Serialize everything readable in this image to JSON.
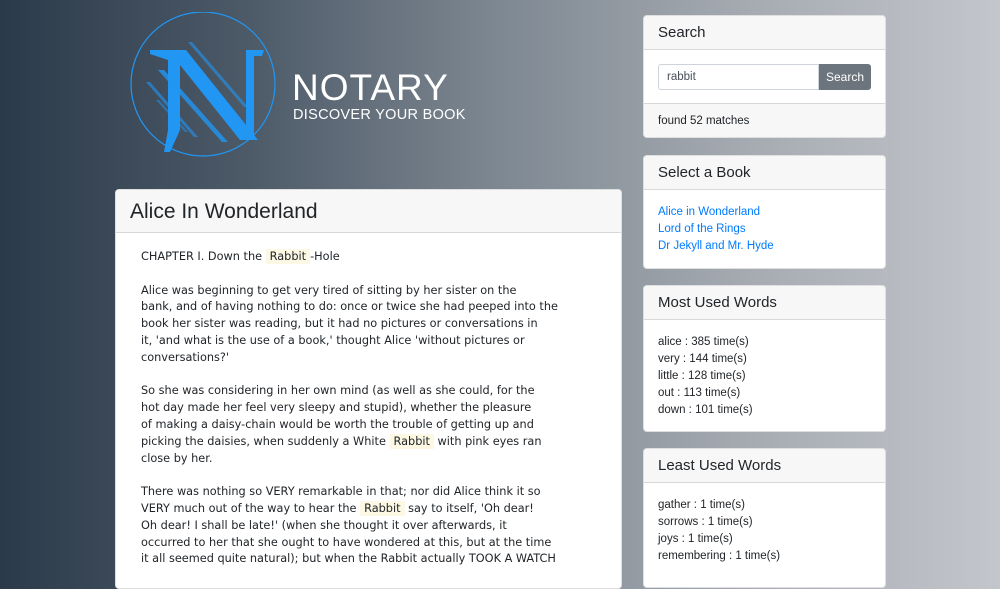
{
  "brand": {
    "title": "NOTARY",
    "subtitle": "DISCOVER YOUR BOOK",
    "accent": "#2196f3"
  },
  "book": {
    "title": "Alice In Wonderland",
    "paragraphs": [
      [
        {
          "t": "CHAPTER I. Down the "
        },
        {
          "t": "Rabbit",
          "hl": true
        },
        {
          "t": "-Hole"
        }
      ],
      [
        {
          "t": "Alice was beginning to get very tired of sitting by her sister on the\nbank, and of having nothing to do: once or twice she had peeped into the\nbook her sister was reading, but it had no pictures or conversations in\nit, 'and what is the use of a book,' thought Alice 'without pictures or\nconversations?'"
        }
      ],
      [
        {
          "t": "So she was considering in her own mind (as well as she could, for the\nhot day made her feel very sleepy and stupid), whether the pleasure\nof making a daisy-chain would be worth the trouble of getting up and\npicking the daisies, when suddenly a White "
        },
        {
          "t": "Rabbit",
          "hl": true
        },
        {
          "t": " with pink eyes ran\nclose by her."
        }
      ],
      [
        {
          "t": "There was nothing so VERY remarkable in that; nor did Alice think it so\nVERY much out of the way to hear the "
        },
        {
          "t": "Rabbit",
          "hl": true
        },
        {
          "t": " say to itself, 'Oh dear!\nOh dear! I shall be late!' (when she thought it over afterwards, it\noccurred to her that she ought to have wondered at this, but at the time\nit all seemed quite natural); but when the Rabbit actually TOOK A WATCH"
        }
      ]
    ]
  },
  "search": {
    "header": "Search",
    "value": "rabbit",
    "button": "Search",
    "result": "found 52 matches"
  },
  "select_book": {
    "header": "Select a Book",
    "books": [
      "Alice in Wonderland",
      "Lord of the Rings",
      "Dr Jekyll and Mr. Hyde"
    ]
  },
  "most_used": {
    "header": "Most Used Words",
    "words": [
      "alice : 385 time(s)",
      "very : 144 time(s)",
      "little : 128 time(s)",
      "out : 113 time(s)",
      "down : 101 time(s)"
    ]
  },
  "least_used": {
    "header": "Least Used Words",
    "words": [
      "gather : 1 time(s)",
      "sorrows : 1 time(s)",
      "joys : 1 time(s)",
      "remembering : 1 time(s)"
    ]
  }
}
